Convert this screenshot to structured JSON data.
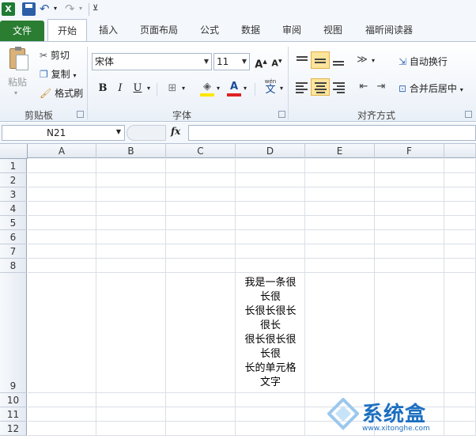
{
  "colors": {
    "file_tab": "#2b7d32",
    "highlight": "#fde49b",
    "font_color_bar": "#e02020",
    "fill_color_bar": "#ffe600",
    "watermark_blue": "#1c6fc1"
  },
  "qat": {
    "icons": [
      "excel-logo-icon",
      "save-icon",
      "undo-icon",
      "redo-icon",
      "customize-qat-icon"
    ]
  },
  "tabs": [
    {
      "label": "文件"
    },
    {
      "label": "开始"
    },
    {
      "label": "插入"
    },
    {
      "label": "页面布局"
    },
    {
      "label": "公式"
    },
    {
      "label": "数据"
    },
    {
      "label": "审阅"
    },
    {
      "label": "视图"
    },
    {
      "label": "福昕阅读器"
    }
  ],
  "ribbon": {
    "clipboard": {
      "paste": "粘贴",
      "cut": "剪切",
      "copy": "复制",
      "format_painter": "格式刷",
      "group": "剪贴板"
    },
    "font": {
      "name": "宋体",
      "size": "11",
      "bold": "B",
      "italic": "I",
      "underline": "U",
      "font_color_letter": "A",
      "wen": "wén",
      "wen_char": "文",
      "group": "字体"
    },
    "alignment": {
      "wrap_text": "自动换行",
      "merge_center": "合并后居中",
      "group": "对齐方式"
    }
  },
  "formula_bar": {
    "name_box": "N21",
    "fx": "fx",
    "value": ""
  },
  "sheet": {
    "columns": [
      "A",
      "B",
      "C",
      "D",
      "E",
      "F"
    ],
    "rows": [
      "1",
      "2",
      "3",
      "4",
      "5",
      "6",
      "7",
      "8",
      "9",
      "10",
      "11",
      "12"
    ],
    "cell_d9_lines": [
      "我是一条很",
      "长很",
      "长很长很长",
      "很长",
      "很长很长很",
      "长很",
      "长的单元格",
      "文字"
    ]
  },
  "watermark": {
    "brand": "系统盒",
    "url": "www.xitonghe.com"
  }
}
